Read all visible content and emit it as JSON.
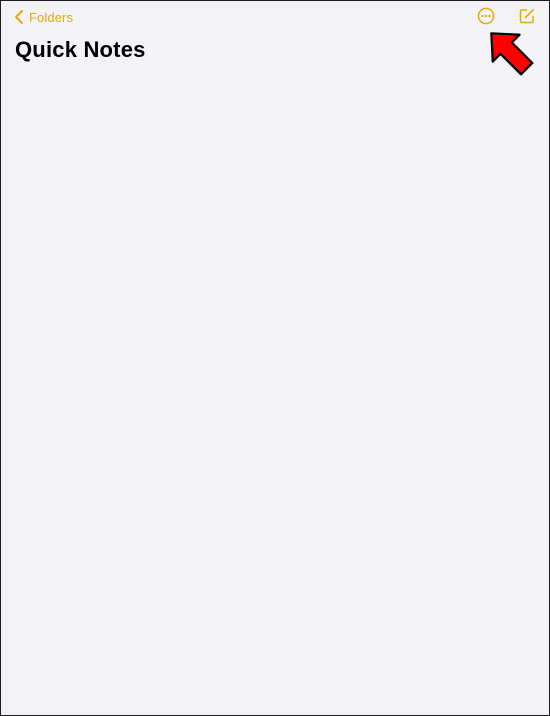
{
  "nav": {
    "back_label": "Folders",
    "back_icon": "chevron-left-icon",
    "more_icon": "ellipsis-circle-icon",
    "compose_icon": "compose-icon"
  },
  "page": {
    "title": "Quick Notes"
  },
  "annotation": {
    "pointer_icon": "red-arrow-icon",
    "target": "compose-button"
  },
  "colors": {
    "accent": "#e2ab05",
    "background": "#f2f2f7",
    "title": "#000000",
    "annotation_fill": "#ff0000",
    "annotation_stroke": "#000000"
  }
}
